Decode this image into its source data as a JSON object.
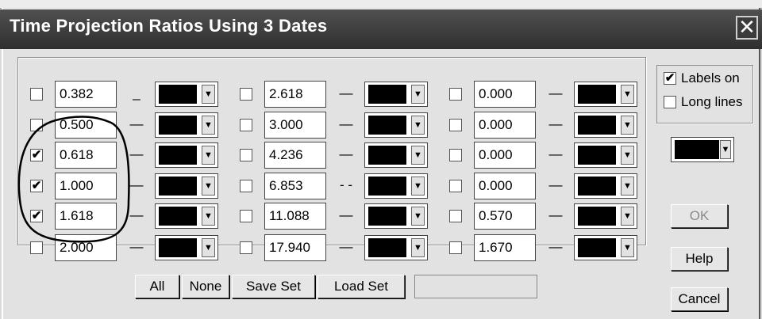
{
  "window": {
    "title": "Time Projection Ratios Using 3 Dates",
    "close_glyph": "✕"
  },
  "columns": [
    {
      "rows": [
        {
          "checked": false,
          "value": "0.382",
          "line": "_"
        },
        {
          "checked": false,
          "value": "0.500",
          "line": "—"
        },
        {
          "checked": true,
          "value": "0.618",
          "line": "—"
        },
        {
          "checked": true,
          "value": "1.000",
          "line": "—"
        },
        {
          "checked": true,
          "value": "1.618",
          "line": "—"
        },
        {
          "checked": false,
          "value": "2.000",
          "line": "—"
        }
      ]
    },
    {
      "rows": [
        {
          "checked": false,
          "value": "2.618",
          "line": "—"
        },
        {
          "checked": false,
          "value": "3.000",
          "line": "—"
        },
        {
          "checked": false,
          "value": "4.236",
          "line": "—"
        },
        {
          "checked": false,
          "value": "6.853",
          "line": "- -"
        },
        {
          "checked": false,
          "value": "11.088",
          "line": "—"
        },
        {
          "checked": false,
          "value": "17.940",
          "line": "—"
        }
      ]
    },
    {
      "rows": [
        {
          "checked": false,
          "value": "0.000",
          "line": "—"
        },
        {
          "checked": false,
          "value": "0.000",
          "line": "—"
        },
        {
          "checked": false,
          "value": "0.000",
          "line": "—"
        },
        {
          "checked": false,
          "value": "0.000",
          "line": "—"
        },
        {
          "checked": false,
          "value": "0.570",
          "line": "—"
        },
        {
          "checked": false,
          "value": "1.670",
          "line": "—"
        }
      ]
    }
  ],
  "color_swatch": "#000000",
  "check_glyph": "✔",
  "dropdown_glyph": "▼",
  "bottom_buttons": {
    "all": "All",
    "none": "None",
    "save_set": "Save Set",
    "load_set": "Load Set"
  },
  "options": {
    "labels_on": {
      "label": "Labels on",
      "checked": true
    },
    "long_lines": {
      "label": "Long lines",
      "checked": false
    }
  },
  "side_buttons": {
    "ok": "OK",
    "help": "Help",
    "cancel": "Cancel"
  }
}
